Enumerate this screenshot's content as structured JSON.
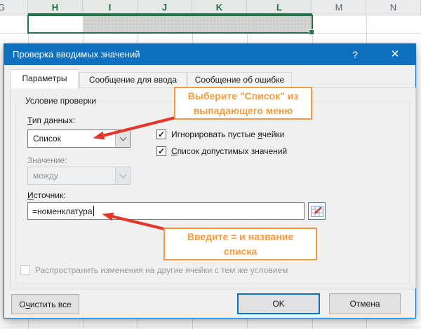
{
  "sheet": {
    "columns": [
      {
        "label": "G",
        "selected": false
      },
      {
        "label": "H",
        "selected": true
      },
      {
        "label": "I",
        "selected": true
      },
      {
        "label": "J",
        "selected": true
      },
      {
        "label": "K",
        "selected": true
      },
      {
        "label": "L",
        "selected": true
      },
      {
        "label": "M",
        "selected": false
      },
      {
        "label": "N",
        "selected": false
      }
    ]
  },
  "dialog": {
    "title": "Проверка вводимых значений",
    "help_label": "?",
    "close_label": "✕",
    "tabs": [
      {
        "label": "Параметры"
      },
      {
        "label": "Сообщение для ввода"
      },
      {
        "label": "Сообщение об ошибке"
      }
    ],
    "group_label": "Условие проверки",
    "fields": {
      "data_type": {
        "label": {
          "pre": "",
          "key": "Т",
          "post": "ип данных:"
        },
        "value": "Список"
      },
      "ignore_blank": {
        "label": {
          "pre": "Игнорировать пустые ",
          "key": "я",
          "post": "чейки"
        },
        "checked": true
      },
      "in_cell_dropdown": {
        "label": {
          "pre": "",
          "key": "С",
          "post": "писок допустимых значений"
        },
        "checked": true
      },
      "data_range": {
        "label": "Значение:",
        "value": "между",
        "enabled": false
      },
      "source": {
        "label": {
          "pre": "",
          "key": "И",
          "post": "сточник:"
        },
        "value": "=номенклатура"
      }
    },
    "apply_all": {
      "label": "Распространить изменения на другие ячейки с тем же условием",
      "checked": false,
      "enabled": false
    },
    "buttons": {
      "clear_all": {
        "pre": "О",
        "key": "ч",
        "post": "истить все"
      },
      "ok": "OK",
      "cancel": "Отмена"
    }
  },
  "annotations": {
    "callout1": {
      "line1": "Выберите \"Список\" из",
      "line2": "выпадающего меню"
    },
    "callout2": {
      "line1": "Введите = и название",
      "line2": "списка"
    },
    "callout_color": "#f79a3c",
    "arrow_color": "#e5352b"
  },
  "colors": {
    "title_bar": "#1070c0",
    "excel_green": "#217346",
    "dialog_bg": "#f0f0f0",
    "selected_fill": "#d4d4d4"
  },
  "icons": {
    "check": "✓"
  }
}
